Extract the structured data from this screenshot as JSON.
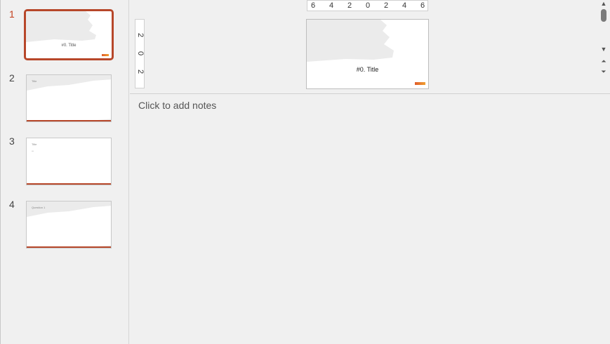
{
  "thumbnails": [
    {
      "number": "1",
      "title": "#0. Title"
    },
    {
      "number": "2",
      "title": "Title"
    },
    {
      "number": "3",
      "title": "Title",
      "subtitle": "•••"
    },
    {
      "number": "4",
      "title": "Question 1"
    }
  ],
  "ruler": {
    "horizontal": [
      "6",
      "4",
      "2",
      "0",
      "2",
      "4",
      "6"
    ],
    "vertical": [
      "2",
      "0",
      "2"
    ]
  },
  "slide": {
    "title": "#0. Title"
  },
  "notes": {
    "placeholder": "Click to add notes"
  },
  "scrollbar": {
    "up_icon": "▲",
    "down_icon": "▼",
    "prev_slide_icon": "⏶",
    "next_slide_icon": "⏷"
  },
  "colors": {
    "accent": "#b7472a",
    "active_number": "#c43e1c"
  }
}
